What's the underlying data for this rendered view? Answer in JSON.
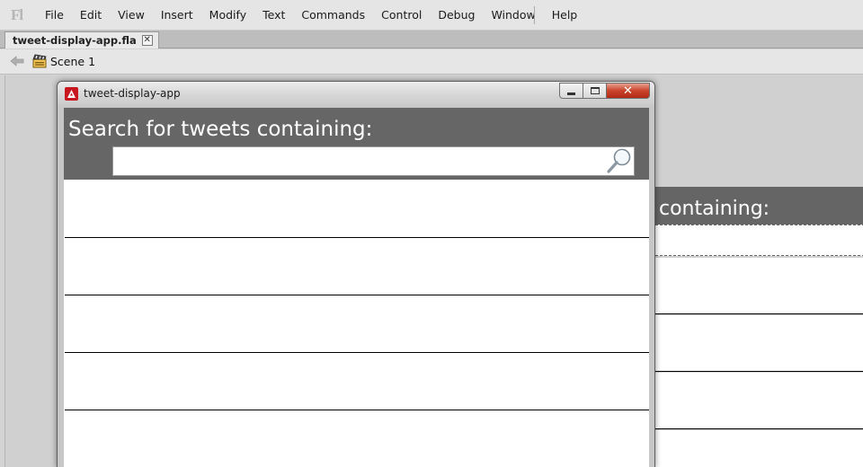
{
  "app": {
    "logo": "Fl",
    "menu": [
      "File",
      "Edit",
      "View",
      "Insert",
      "Modify",
      "Text",
      "Commands",
      "Control",
      "Debug",
      "Window",
      "Help"
    ]
  },
  "document_tab": {
    "label": "tweet-display-app.fla",
    "close_glyph": "✕"
  },
  "editbar": {
    "scene_label": "Scene 1"
  },
  "stage_app": {
    "header_text": "containing:"
  },
  "preview_window": {
    "title": "tweet-display-app",
    "header_text": "Search for tweets containing:",
    "search_value": "",
    "list_items": [
      "",
      "",
      "",
      "",
      ""
    ]
  },
  "colors": {
    "app_header": "#666666",
    "close_button": "#c9432b",
    "window_icon": "#c8161e"
  },
  "icons": [
    "back-arrow-icon",
    "scene-icon",
    "air-app-icon",
    "minimize-icon",
    "maximize-icon",
    "close-icon",
    "search-icon"
  ]
}
